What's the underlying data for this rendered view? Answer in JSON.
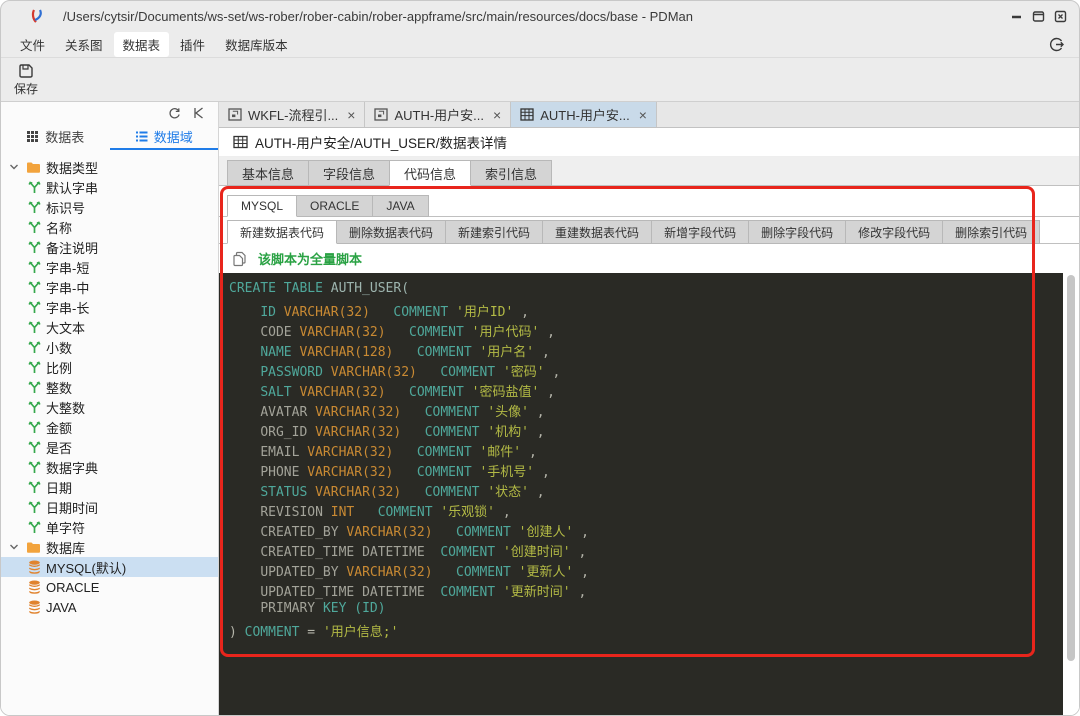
{
  "window": {
    "title": "/Users/cytsir/Documents/ws-set/ws-rober/rober-cabin/rober-appframe/src/main/resources/docs/base - PDMan",
    "controls": [
      "minimize",
      "maximize",
      "close"
    ]
  },
  "menu_bar": {
    "items": [
      {
        "label": "文件",
        "active": false
      },
      {
        "label": "关系图",
        "active": false
      },
      {
        "label": "数据表",
        "active": true
      },
      {
        "label": "插件",
        "active": false
      },
      {
        "label": "数据库版本",
        "active": false
      }
    ]
  },
  "toolbar": {
    "save_label": "保存"
  },
  "sidebar": {
    "header_icons": [
      "refresh",
      "collapse"
    ],
    "tabs": [
      {
        "label": "数据表",
        "icon": "grid-icon",
        "active": false
      },
      {
        "label": "数据域",
        "icon": "list-icon",
        "active": true
      }
    ],
    "tree": [
      {
        "label": "数据类型",
        "icon": "folder",
        "folder": true,
        "expanded": true,
        "selected": false
      },
      {
        "label": "默认字串",
        "icon": "datatype",
        "folder": false,
        "selected": false
      },
      {
        "label": "标识号",
        "icon": "datatype",
        "folder": false,
        "selected": false
      },
      {
        "label": "名称",
        "icon": "datatype",
        "folder": false,
        "selected": false
      },
      {
        "label": "备注说明",
        "icon": "datatype",
        "folder": false,
        "selected": false
      },
      {
        "label": "字串-短",
        "icon": "datatype",
        "folder": false,
        "selected": false
      },
      {
        "label": "字串-中",
        "icon": "datatype",
        "folder": false,
        "selected": false
      },
      {
        "label": "字串-长",
        "icon": "datatype",
        "folder": false,
        "selected": false
      },
      {
        "label": "大文本",
        "icon": "datatype",
        "folder": false,
        "selected": false
      },
      {
        "label": "小数",
        "icon": "datatype",
        "folder": false,
        "selected": false
      },
      {
        "label": "比例",
        "icon": "datatype",
        "folder": false,
        "selected": false
      },
      {
        "label": "整数",
        "icon": "datatype",
        "folder": false,
        "selected": false
      },
      {
        "label": "大整数",
        "icon": "datatype",
        "folder": false,
        "selected": false
      },
      {
        "label": "金额",
        "icon": "datatype",
        "folder": false,
        "selected": false
      },
      {
        "label": "是否",
        "icon": "datatype",
        "folder": false,
        "selected": false
      },
      {
        "label": "数据字典",
        "icon": "datatype",
        "folder": false,
        "selected": false
      },
      {
        "label": "日期",
        "icon": "datatype",
        "folder": false,
        "selected": false
      },
      {
        "label": "日期时间",
        "icon": "datatype",
        "folder": false,
        "selected": false
      },
      {
        "label": "单字符",
        "icon": "datatype",
        "folder": false,
        "selected": false
      },
      {
        "label": "数据库",
        "icon": "folder",
        "folder": true,
        "expanded": true,
        "selected": false
      },
      {
        "label": "MYSQL(默认)",
        "icon": "database",
        "folder": false,
        "selected": true
      },
      {
        "label": "ORACLE",
        "icon": "database",
        "folder": false,
        "selected": false
      },
      {
        "label": "JAVA",
        "icon": "database",
        "folder": false,
        "selected": false
      }
    ]
  },
  "main": {
    "doc_tabs": [
      {
        "label": "WKFL-流程引...",
        "icon": "diagram-icon",
        "active": false,
        "close": "×"
      },
      {
        "label": "AUTH-用户安...",
        "icon": "diagram-icon",
        "active": false,
        "close": "×"
      },
      {
        "label": "AUTH-用户安...",
        "icon": "table-grid-icon",
        "active": true,
        "close": "×"
      }
    ],
    "breadcrumb": "AUTH-用户安全/AUTH_USER/数据表详情",
    "detail_tabs": [
      {
        "label": "基本信息",
        "active": false
      },
      {
        "label": "字段信息",
        "active": false
      },
      {
        "label": "代码信息",
        "active": true
      },
      {
        "label": "索引信息",
        "active": false
      }
    ],
    "db_tabs": [
      {
        "label": "MYSQL",
        "active": true
      },
      {
        "label": "ORACLE",
        "active": false
      },
      {
        "label": "JAVA",
        "active": false
      }
    ],
    "code_tabs": [
      {
        "label": "新建数据表代码",
        "active": true
      },
      {
        "label": "删除数据表代码",
        "active": false
      },
      {
        "label": "新建索引代码",
        "active": false
      },
      {
        "label": "重建数据表代码",
        "active": false
      },
      {
        "label": "新增字段代码",
        "active": false
      },
      {
        "label": "删除字段代码",
        "active": false
      },
      {
        "label": "修改字段代码",
        "active": false
      },
      {
        "label": "删除索引代码",
        "active": false
      }
    ],
    "note": "该脚本为全量脚本"
  },
  "code": {
    "lines": [
      [
        [
          "kw",
          "CREATE TABLE "
        ],
        [
          "tname",
          "AUTH_USER("
        ]
      ],
      [
        [
          "pl",
          "    "
        ],
        [
          "kw",
          "ID"
        ],
        [
          "pl",
          " "
        ],
        [
          "type",
          "VARCHAR(32)"
        ],
        [
          "pl",
          "   "
        ],
        [
          "kw",
          "COMMENT"
        ],
        [
          "pl",
          " "
        ],
        [
          "str",
          "'用户ID'"
        ],
        [
          "punc",
          " ,"
        ]
      ],
      [
        [
          "pl",
          "    "
        ],
        [
          "id",
          "CODE"
        ],
        [
          "pl",
          " "
        ],
        [
          "type",
          "VARCHAR(32)"
        ],
        [
          "pl",
          "   "
        ],
        [
          "kw",
          "COMMENT"
        ],
        [
          "pl",
          " "
        ],
        [
          "str",
          "'用户代码'"
        ],
        [
          "punc",
          " ,"
        ]
      ],
      [
        [
          "pl",
          "    "
        ],
        [
          "kw",
          "NAME"
        ],
        [
          "pl",
          " "
        ],
        [
          "type",
          "VARCHAR(128)"
        ],
        [
          "pl",
          "   "
        ],
        [
          "kw",
          "COMMENT"
        ],
        [
          "pl",
          " "
        ],
        [
          "str",
          "'用户名'"
        ],
        [
          "punc",
          " ,"
        ]
      ],
      [
        [
          "pl",
          "    "
        ],
        [
          "kw",
          "PASSWORD"
        ],
        [
          "pl",
          " "
        ],
        [
          "type",
          "VARCHAR(32)"
        ],
        [
          "pl",
          "   "
        ],
        [
          "kw",
          "COMMENT"
        ],
        [
          "pl",
          " "
        ],
        [
          "str",
          "'密码'"
        ],
        [
          "punc",
          " ,"
        ]
      ],
      [
        [
          "pl",
          "    "
        ],
        [
          "kw",
          "SALT"
        ],
        [
          "pl",
          " "
        ],
        [
          "type",
          "VARCHAR(32)"
        ],
        [
          "pl",
          "   "
        ],
        [
          "kw",
          "COMMENT"
        ],
        [
          "pl",
          " "
        ],
        [
          "str",
          "'密码盐值'"
        ],
        [
          "punc",
          " ,"
        ]
      ],
      [
        [
          "pl",
          "    "
        ],
        [
          "id",
          "AVATAR"
        ],
        [
          "pl",
          " "
        ],
        [
          "type",
          "VARCHAR(32)"
        ],
        [
          "pl",
          "   "
        ],
        [
          "kw",
          "COMMENT"
        ],
        [
          "pl",
          " "
        ],
        [
          "str",
          "'头像'"
        ],
        [
          "punc",
          " ,"
        ]
      ],
      [
        [
          "pl",
          "    "
        ],
        [
          "id",
          "ORG_ID"
        ],
        [
          "pl",
          " "
        ],
        [
          "type",
          "VARCHAR(32)"
        ],
        [
          "pl",
          "   "
        ],
        [
          "kw",
          "COMMENT"
        ],
        [
          "pl",
          " "
        ],
        [
          "str",
          "'机构'"
        ],
        [
          "punc",
          " ,"
        ]
      ],
      [
        [
          "pl",
          "    "
        ],
        [
          "id",
          "EMAIL"
        ],
        [
          "pl",
          " "
        ],
        [
          "type",
          "VARCHAR(32)"
        ],
        [
          "pl",
          "   "
        ],
        [
          "kw",
          "COMMENT"
        ],
        [
          "pl",
          " "
        ],
        [
          "str",
          "'邮件'"
        ],
        [
          "punc",
          " ,"
        ]
      ],
      [
        [
          "pl",
          "    "
        ],
        [
          "id",
          "PHONE"
        ],
        [
          "pl",
          " "
        ],
        [
          "type",
          "VARCHAR(32)"
        ],
        [
          "pl",
          "   "
        ],
        [
          "kw",
          "COMMENT"
        ],
        [
          "pl",
          " "
        ],
        [
          "str",
          "'手机号'"
        ],
        [
          "punc",
          " ,"
        ]
      ],
      [
        [
          "pl",
          "    "
        ],
        [
          "kw",
          "STATUS"
        ],
        [
          "pl",
          " "
        ],
        [
          "type",
          "VARCHAR(32)"
        ],
        [
          "pl",
          "   "
        ],
        [
          "kw",
          "COMMENT"
        ],
        [
          "pl",
          " "
        ],
        [
          "str",
          "'状态'"
        ],
        [
          "punc",
          " ,"
        ]
      ],
      [
        [
          "pl",
          "    "
        ],
        [
          "id",
          "REVISION"
        ],
        [
          "pl",
          " "
        ],
        [
          "type",
          "INT"
        ],
        [
          "pl",
          "   "
        ],
        [
          "kw",
          "COMMENT"
        ],
        [
          "pl",
          " "
        ],
        [
          "str",
          "'乐观锁'"
        ],
        [
          "punc",
          " ,"
        ]
      ],
      [
        [
          "pl",
          "    "
        ],
        [
          "id",
          "CREATED_BY"
        ],
        [
          "pl",
          " "
        ],
        [
          "type",
          "VARCHAR(32)"
        ],
        [
          "pl",
          "   "
        ],
        [
          "kw",
          "COMMENT"
        ],
        [
          "pl",
          " "
        ],
        [
          "str",
          "'创建人'"
        ],
        [
          "punc",
          " ,"
        ]
      ],
      [
        [
          "pl",
          "    "
        ],
        [
          "id",
          "CREATED_TIME"
        ],
        [
          "pl",
          " "
        ],
        [
          "id",
          "DATETIME"
        ],
        [
          "pl",
          "  "
        ],
        [
          "kw",
          "COMMENT"
        ],
        [
          "pl",
          " "
        ],
        [
          "str",
          "'创建时间'"
        ],
        [
          "punc",
          " ,"
        ]
      ],
      [
        [
          "pl",
          "    "
        ],
        [
          "id",
          "UPDATED_BY"
        ],
        [
          "pl",
          " "
        ],
        [
          "type",
          "VARCHAR(32)"
        ],
        [
          "pl",
          "   "
        ],
        [
          "kw",
          "COMMENT"
        ],
        [
          "pl",
          " "
        ],
        [
          "str",
          "'更新人'"
        ],
        [
          "punc",
          " ,"
        ]
      ],
      [
        [
          "pl",
          "    "
        ],
        [
          "id",
          "UPDATED_TIME"
        ],
        [
          "pl",
          " "
        ],
        [
          "id",
          "DATETIME"
        ],
        [
          "pl",
          "  "
        ],
        [
          "kw",
          "COMMENT"
        ],
        [
          "pl",
          " "
        ],
        [
          "str",
          "'更新时间'"
        ],
        [
          "punc",
          " ,"
        ]
      ],
      [
        [
          "pl",
          "    "
        ],
        [
          "id",
          "PRIMARY "
        ],
        [
          "kw",
          "KEY "
        ],
        [
          "kw",
          "(ID)"
        ]
      ],
      [
        [
          "punc",
          ") "
        ],
        [
          "kw",
          "COMMENT"
        ],
        [
          "punc",
          " = "
        ],
        [
          "str",
          "'用户信息;'"
        ]
      ]
    ]
  },
  "colors": {
    "accent_blue": "#1f7ce8",
    "note_green": "#2aa244",
    "annotation_red": "#e8251c",
    "active_tab_blue": "#c9dae9",
    "code_background": "#2a2a25",
    "syntax_keyword": "#4fa89b",
    "syntax_type": "#c98a33",
    "syntax_identifier": "#a3a399",
    "syntax_string": "#b3ba45"
  }
}
